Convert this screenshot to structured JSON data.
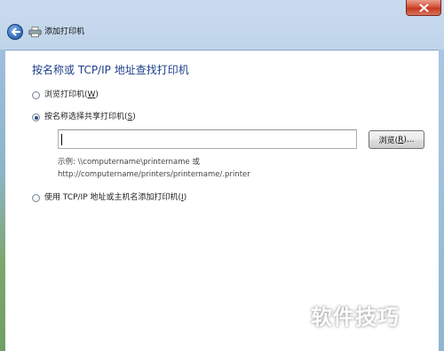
{
  "titlebar": {
    "title": "添加打印机"
  },
  "icons": {
    "back": "back-arrow-icon",
    "close": "close-icon",
    "wizard": "printer-icon"
  },
  "main": {
    "heading": "按名称或 TCP/IP 地址查找打印机",
    "options": [
      {
        "label": "浏览打印机(",
        "key": "W",
        "suffix": ")",
        "selected": false
      },
      {
        "label": "按名称选择共享打印机(",
        "key": "S",
        "suffix": ")",
        "selected": true
      },
      {
        "label": "使用 TCP/IP 地址或主机名添加打印机(",
        "key": "I",
        "suffix": ")",
        "selected": false
      }
    ],
    "printer_name_input": {
      "value": ""
    },
    "browse_button": {
      "label": "浏览(",
      "key": "R",
      "suffix": ")..."
    },
    "example": {
      "line1": "示例: \\\\computername\\printername 或",
      "line2": "http://computername/printers/printername/.printer"
    }
  },
  "watermark": "软件技巧",
  "colors": {
    "heading": "#1e3f8a",
    "close_button": "#c43a20",
    "frame": "#b7cde6"
  }
}
